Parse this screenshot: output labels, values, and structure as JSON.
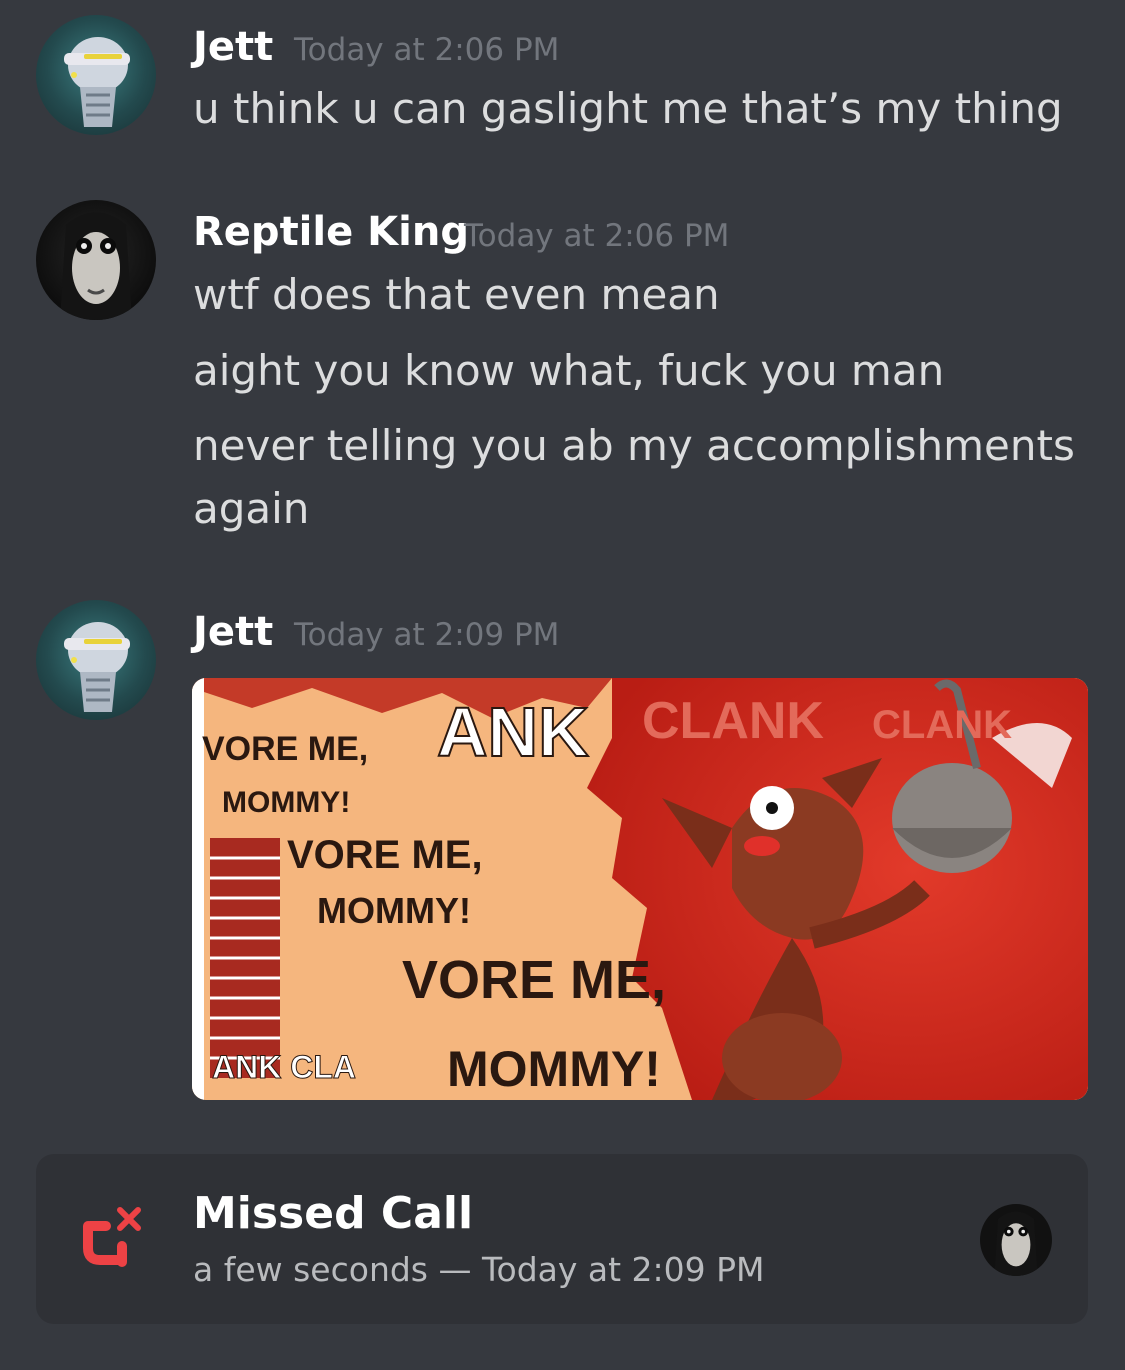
{
  "messages": [
    {
      "author": "Jett",
      "timestamp": "Today at 2:06 PM",
      "lines": [
        "u think u can gaslight me that’s my thing"
      ]
    },
    {
      "author": "Reptile King",
      "timestamp": "Today at 2:06 PM",
      "lines": [
        "wtf does that even mean",
        "aight you know what, fuck you man",
        "never telling you ab my accomplishments",
        "again"
      ]
    },
    {
      "author": "Jett",
      "timestamp": "Today at 2:09 PM",
      "image": {
        "texts": [
          "VORE ME,",
          "MOMMY!",
          "VORE ME,",
          "MOMMY!",
          "VORE ME,",
          "MOMMY!",
          "ANK",
          "CLANK",
          "CLANK",
          "ANK CLA"
        ]
      }
    }
  ],
  "missed_call": {
    "title": "Missed Call",
    "subtitle": "a few seconds — Today at 2:09 PM",
    "icon": "missed-call-icon",
    "icon_color": "#ed4245"
  },
  "colors": {
    "background": "#36393f",
    "card": "#2f3136",
    "username": "#ffffff",
    "timestamp": "#72767d",
    "message": "#dcddde"
  }
}
